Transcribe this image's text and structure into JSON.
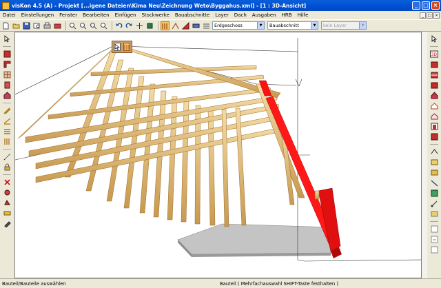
{
  "window": {
    "title": "visKon 4.5 (A) - Projekt [...igene Dateien\\Kima Neu\\Zeichnung Weto\\Byggahus.xml] - [1 : 3D-Ansicht]",
    "minimize": "_",
    "maximize": "□",
    "close": "×"
  },
  "menu": {
    "items": [
      "Datei",
      "Einstellungen",
      "Fenster",
      "Bearbeiten",
      "Einfügen",
      "Stockwerke",
      "Bauabschnitte",
      "Layer",
      "Dach",
      "Ausgaben",
      "HRB",
      "Hilfe"
    ],
    "mdi": [
      "_",
      "□",
      "×"
    ]
  },
  "toolbar": {
    "story_select": "Erdgeschoss",
    "section_select": "Bauabschnitt",
    "layer_select": "kein Layer"
  },
  "statusbar": {
    "left": "Bauteil/Bauteile auswählen",
    "center": "Bauteil ( Mehrfachauswahl SHIFT-Taste festhalten )"
  },
  "colors": {
    "titlebar": "#0254d6",
    "selected_beam": "#ff1010",
    "timber": "#e8c27a",
    "slab": "#bdbdbd"
  },
  "icons": {
    "left": [
      "cursor-icon",
      "wall-icon",
      "wall-corner-icon",
      "window-icon",
      "door-icon",
      "house-icon",
      "stairs-icon",
      "roof-icon",
      "beam-icon",
      "column-icon",
      "ruler-icon",
      "lock-icon",
      "delete-icon",
      "move-icon",
      "rotate-icon",
      "measure-icon",
      "tool-icon"
    ],
    "right": [
      "cursor-icon",
      "view-3d-icon",
      "building-icon",
      "section-icon",
      "wall-icon",
      "roof-icon",
      "house-icon",
      "window-icon",
      "door-icon",
      "slab-icon",
      "line-icon",
      "polygon-icon",
      "circle-icon",
      "arc-icon",
      "text-icon",
      "dimension-icon",
      "grid-icon",
      "zoom-icon"
    ]
  }
}
